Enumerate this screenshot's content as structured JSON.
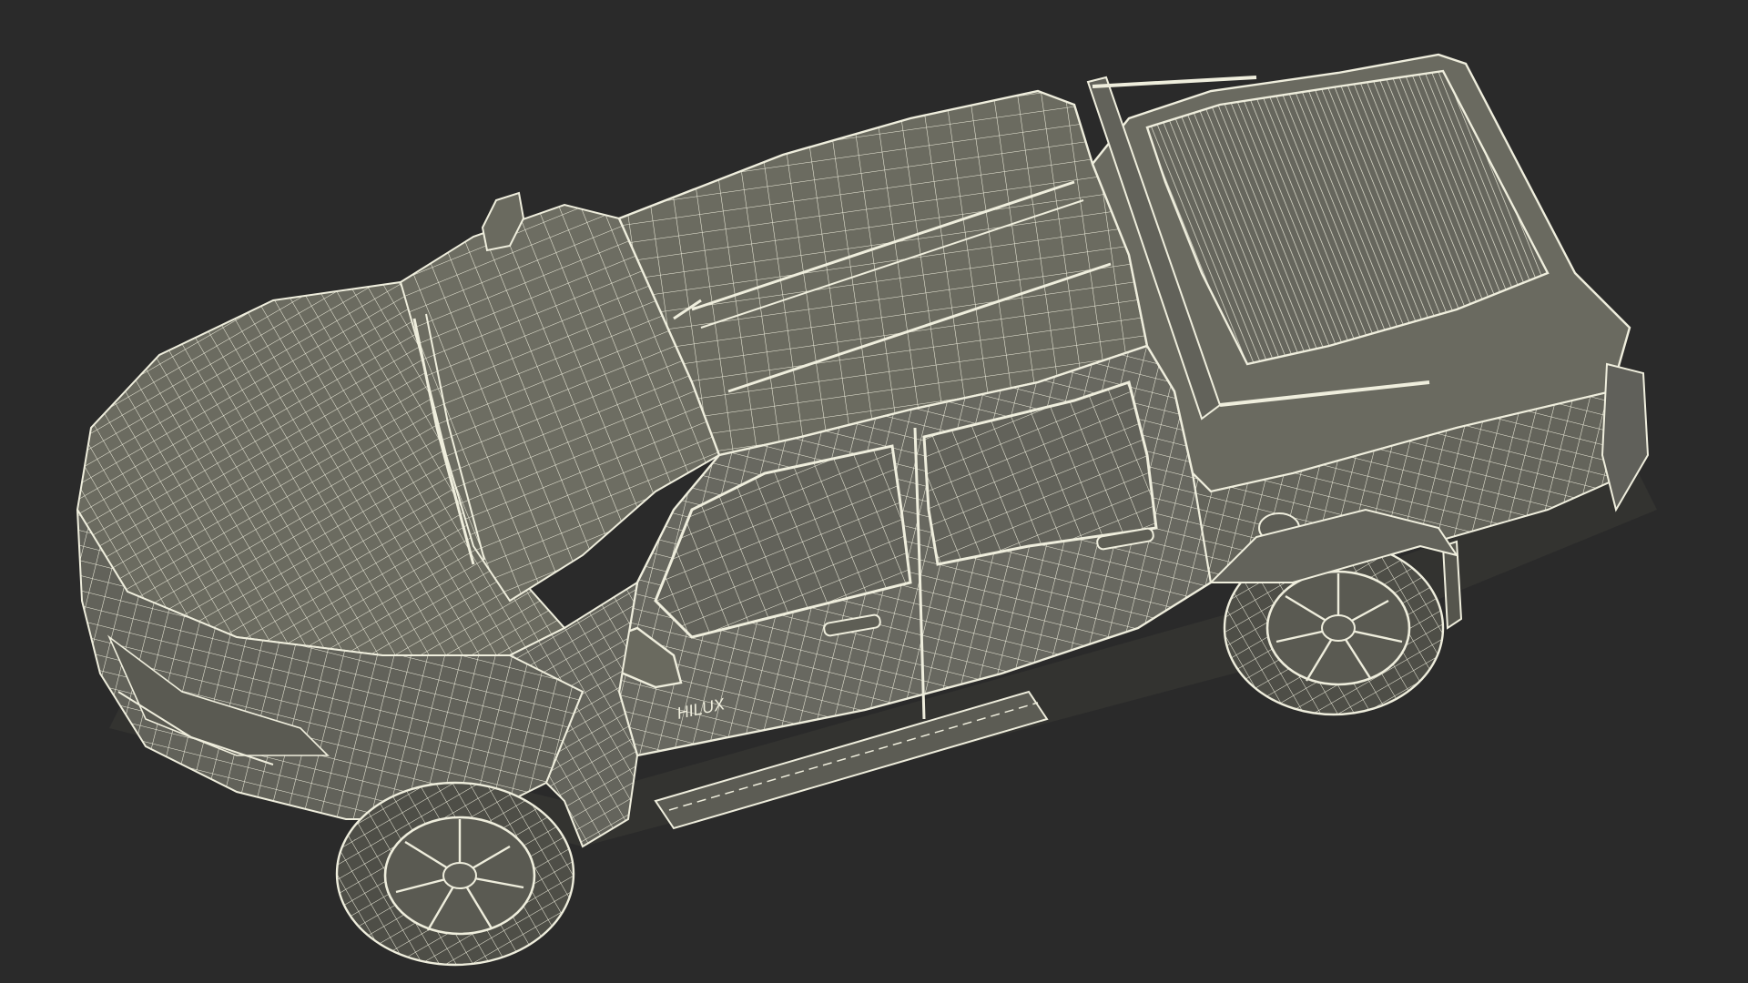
{
  "scene": {
    "background_color": "#2a2a2a",
    "wire_color": "#efeedd",
    "fill_color": "#6b6b60",
    "fill_dark": "#58584f",
    "tire_color": "#4e4e47",
    "subject": "pickup-truck-wireframe"
  },
  "badge": {
    "text": "HILUX"
  }
}
